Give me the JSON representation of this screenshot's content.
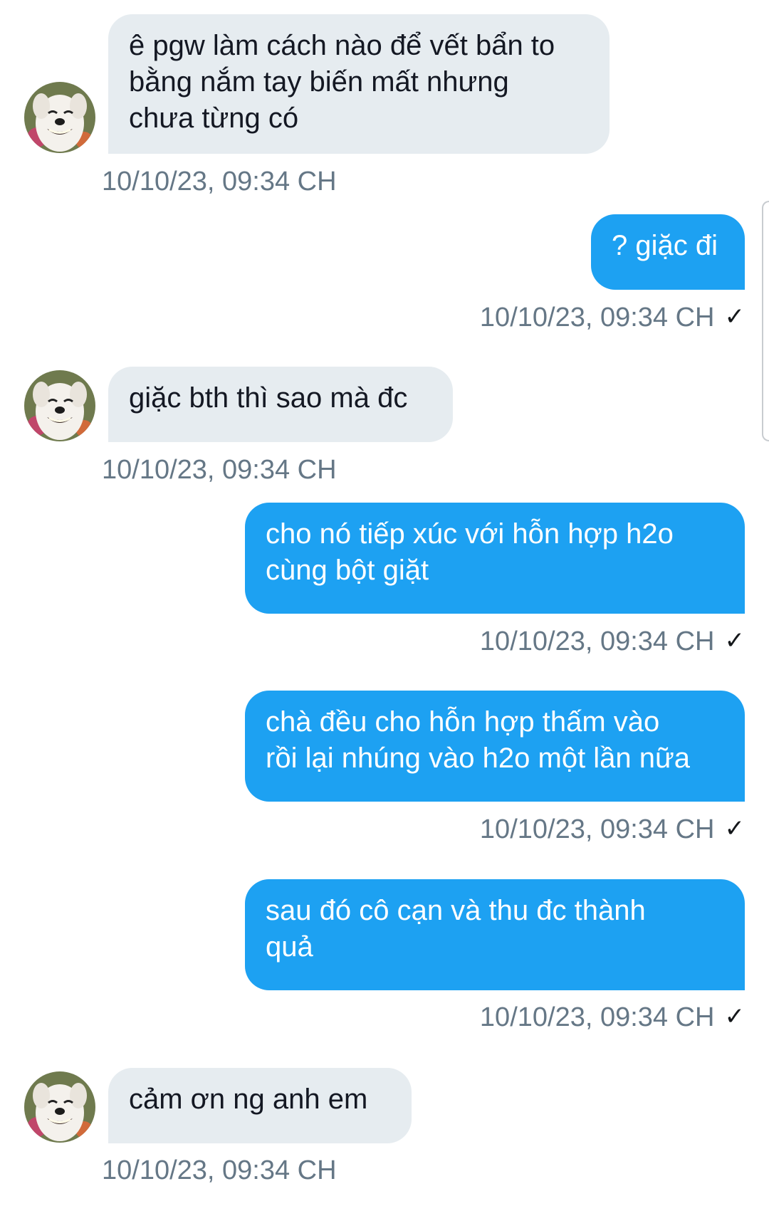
{
  "conversation": {
    "avatar_icon": "smiling-dog-avatar-icon",
    "read_icon": "checkmark-icon",
    "messages": [
      {
        "direction": "in",
        "lines": [
          "ê pgw làm cách nào để vết bẩn to",
          "bằng nắm tay biến mất nhưng",
          "chưa từng có"
        ],
        "time": "10/10/23, 09:34 CH"
      },
      {
        "direction": "out",
        "lines": [
          "? giặc đi"
        ],
        "time": "10/10/23, 09:34 CH",
        "check": "✓"
      },
      {
        "direction": "in",
        "lines": [
          "giặc bth thì sao mà đc"
        ],
        "time": "10/10/23, 09:34 CH"
      },
      {
        "direction": "out",
        "lines": [
          "cho nó tiếp xúc với hỗn hợp h2o",
          "cùng bột giặt"
        ],
        "time": "10/10/23, 09:34 CH",
        "check": "✓"
      },
      {
        "direction": "out",
        "lines": [
          "chà đều cho hỗn hợp thấm vào",
          "rồi lại nhúng vào h2o một lần nữa"
        ],
        "time": "10/10/23, 09:34 CH",
        "check": "✓"
      },
      {
        "direction": "out",
        "lines": [
          "sau đó cô cạn và thu đc thành",
          "quả"
        ],
        "time": "10/10/23, 09:34 CH",
        "check": "✓"
      },
      {
        "direction": "in",
        "lines": [
          "cảm ơn ng anh em"
        ],
        "time": "10/10/23, 09:34 CH"
      }
    ]
  },
  "colors": {
    "incoming_bubble": "#e6ecf0",
    "outgoing_bubble": "#1da1f2",
    "timestamp": "#657786"
  }
}
